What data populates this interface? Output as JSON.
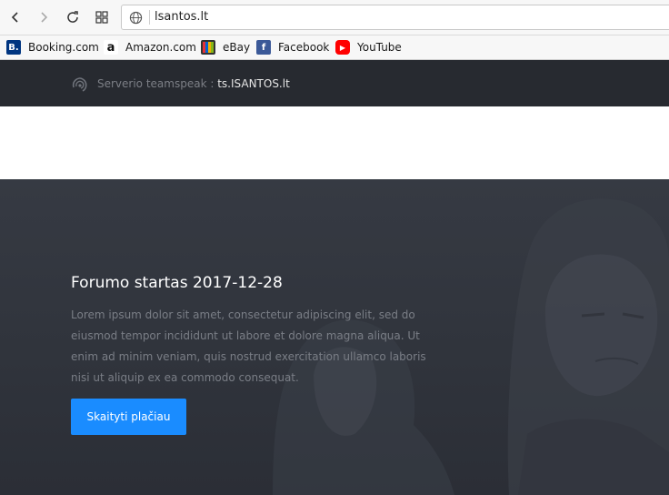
{
  "browser": {
    "url": "lsantos.lt"
  },
  "bookmarks": [
    {
      "label": "Booking.com",
      "icon": "booking-icon",
      "color": "#003580",
      "glyph": "B."
    },
    {
      "label": "Amazon.com",
      "icon": "amazon-icon",
      "color": "#ffffff",
      "glyph": "a"
    },
    {
      "label": "eBay",
      "icon": "ebay-icon",
      "color": "#e53238",
      "glyph": ""
    },
    {
      "label": "Facebook",
      "icon": "facebook-icon",
      "color": "#3b5998",
      "glyph": "f"
    },
    {
      "label": "YouTube",
      "icon": "youtube-icon",
      "color": "#ff0000",
      "glyph": "▶"
    }
  ],
  "site": {
    "teamspeak_label": "Serverio teamspeak : ",
    "teamspeak_host": "ts.ISANTOS.lt"
  },
  "hero": {
    "title": "Forumo startas 2017-12-28",
    "text": "Lorem ipsum dolor sit amet, consectetur adipiscing elit, sed do eiusmod tempor incididunt ut labore et dolore magna aliqua. Ut enim ad minim veniam, quis nostrud exercitation ullamco laboris nisi ut aliquip ex ea commodo consequat.",
    "button_label": "Skaityti plačiau"
  },
  "colors": {
    "accent": "#1a8cff",
    "topbar": "#272a30",
    "hero_bg": "#31353d"
  }
}
